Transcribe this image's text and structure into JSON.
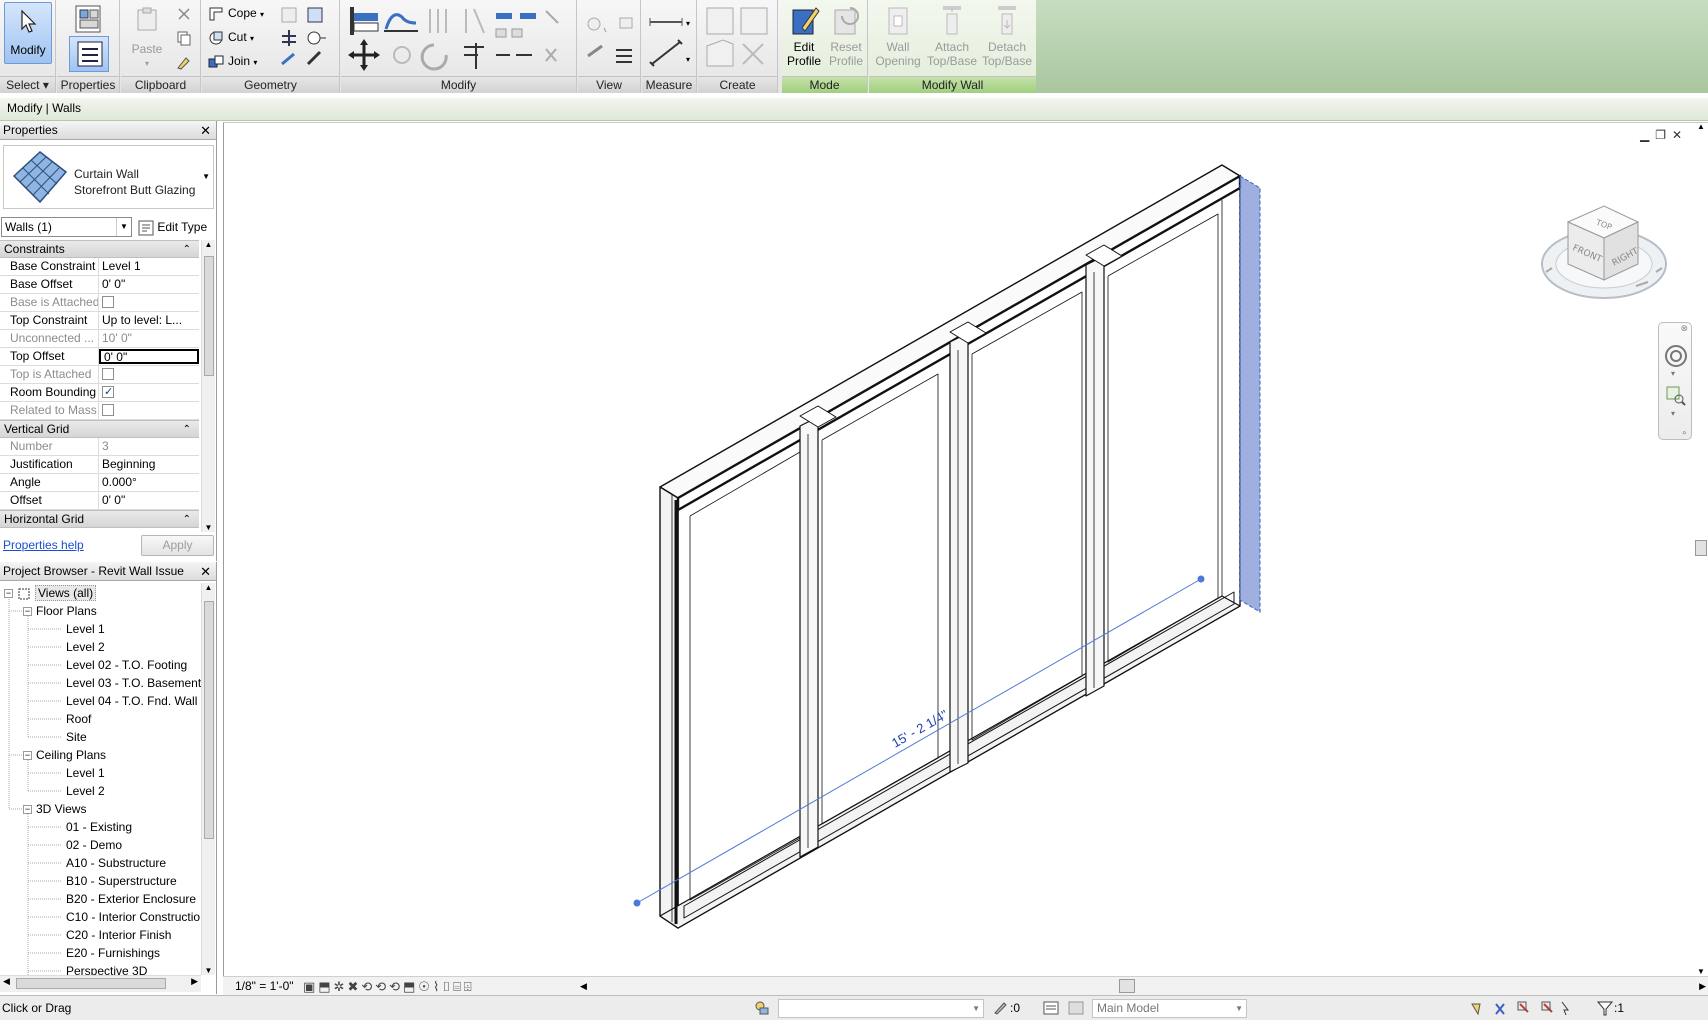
{
  "ribbon": {
    "select": {
      "modify_label": "Modify",
      "panel": "Select"
    },
    "properties": {
      "panel": "Properties"
    },
    "clipboard": {
      "paste_label": "Paste",
      "panel": "Clipboard"
    },
    "geometry": {
      "cope": "Cope",
      "cut": "Cut",
      "join": "Join",
      "panel": "Geometry"
    },
    "modify_panel": "Modify",
    "view_panel": "View",
    "measure_panel": "Measure",
    "create_panel": "Create",
    "mode": {
      "edit_profile_1": "Edit",
      "edit_profile_2": "Profile",
      "reset_profile_1": "Reset",
      "reset_profile_2": "Profile",
      "panel": "Mode"
    },
    "modify_wall": {
      "wall_opening_1": "Wall",
      "wall_opening_2": "Opening",
      "attach_1": "Attach",
      "attach_2": "Top/Base",
      "detach_1": "Detach",
      "detach_2": "Top/Base",
      "panel": "Modify Wall"
    }
  },
  "context_bar": "Modify | Walls",
  "properties_panel": {
    "title": "Properties",
    "type_family": "Curtain Wall",
    "type_name": "Storefront Butt Glazing",
    "selector": "Walls (1)",
    "edit_type": "Edit Type",
    "groups": {
      "constraints": "Constraints",
      "vertical_grid": "Vertical Grid",
      "horizontal_grid": "Horizontal Grid"
    },
    "constraints": [
      {
        "key": "Base Constraint",
        "value": "Level 1"
      },
      {
        "key": "Base Offset",
        "value": "0'  0\""
      },
      {
        "key": "Base is Attached",
        "value": ""
      },
      {
        "key": "Top Constraint",
        "value": "Up to level: L..."
      },
      {
        "key": "Unconnected ...",
        "value": "10'  0\""
      },
      {
        "key": "Top Offset",
        "value": "0'  0\""
      },
      {
        "key": "Top is Attached",
        "value": ""
      },
      {
        "key": "Room Bounding",
        "value": ""
      },
      {
        "key": "Related to Mass",
        "value": ""
      }
    ],
    "vertical_grid": [
      {
        "key": "Number",
        "value": "3"
      },
      {
        "key": "Justification",
        "value": "Beginning"
      },
      {
        "key": "Angle",
        "value": "0.000°"
      },
      {
        "key": "Offset",
        "value": "0'  0\""
      }
    ],
    "help_link": "Properties help",
    "apply_label": "Apply"
  },
  "project_browser": {
    "title": "Project Browser - Revit Wall Issue",
    "root": "Views (all)",
    "floor_plans": "Floor Plans",
    "floor_plan_items": [
      "Level 1",
      "Level 2",
      "Level 02 - T.O. Footing",
      "Level 03 - T.O. Basement",
      "Level 04 - T.O. Fnd. Wall",
      "Roof",
      "Site"
    ],
    "ceiling_plans": "Ceiling Plans",
    "ceiling_plan_items": [
      "Level 1",
      "Level 2"
    ],
    "views_3d": "3D Views",
    "views_3d_items": [
      "01 - Existing",
      "02 - Demo",
      "A10 - Substructure",
      "B10 - Superstructure",
      "B20 - Exterior Enclosure",
      "C10 - Interior Constructio",
      "C20 - Interior Finish",
      "E20 - Furnishings",
      "Perspective 3D"
    ]
  },
  "canvas": {
    "dimension_text": "15' - 2 1/4\"",
    "viewcube_top": "TOP",
    "viewcube_front": "FRONT",
    "viewcube_right": "RIGHT"
  },
  "view_control": {
    "scale": "1/8\" = 1'-0\""
  },
  "status": {
    "message": "Click or Drag",
    "editable_count": ":0",
    "model": "Main Model",
    "filter_count": ":1"
  },
  "colors": {
    "ribbon_green": "#a9c79f",
    "selection_blue": "#3b5fc4",
    "link_blue": "#1b4fd0"
  }
}
